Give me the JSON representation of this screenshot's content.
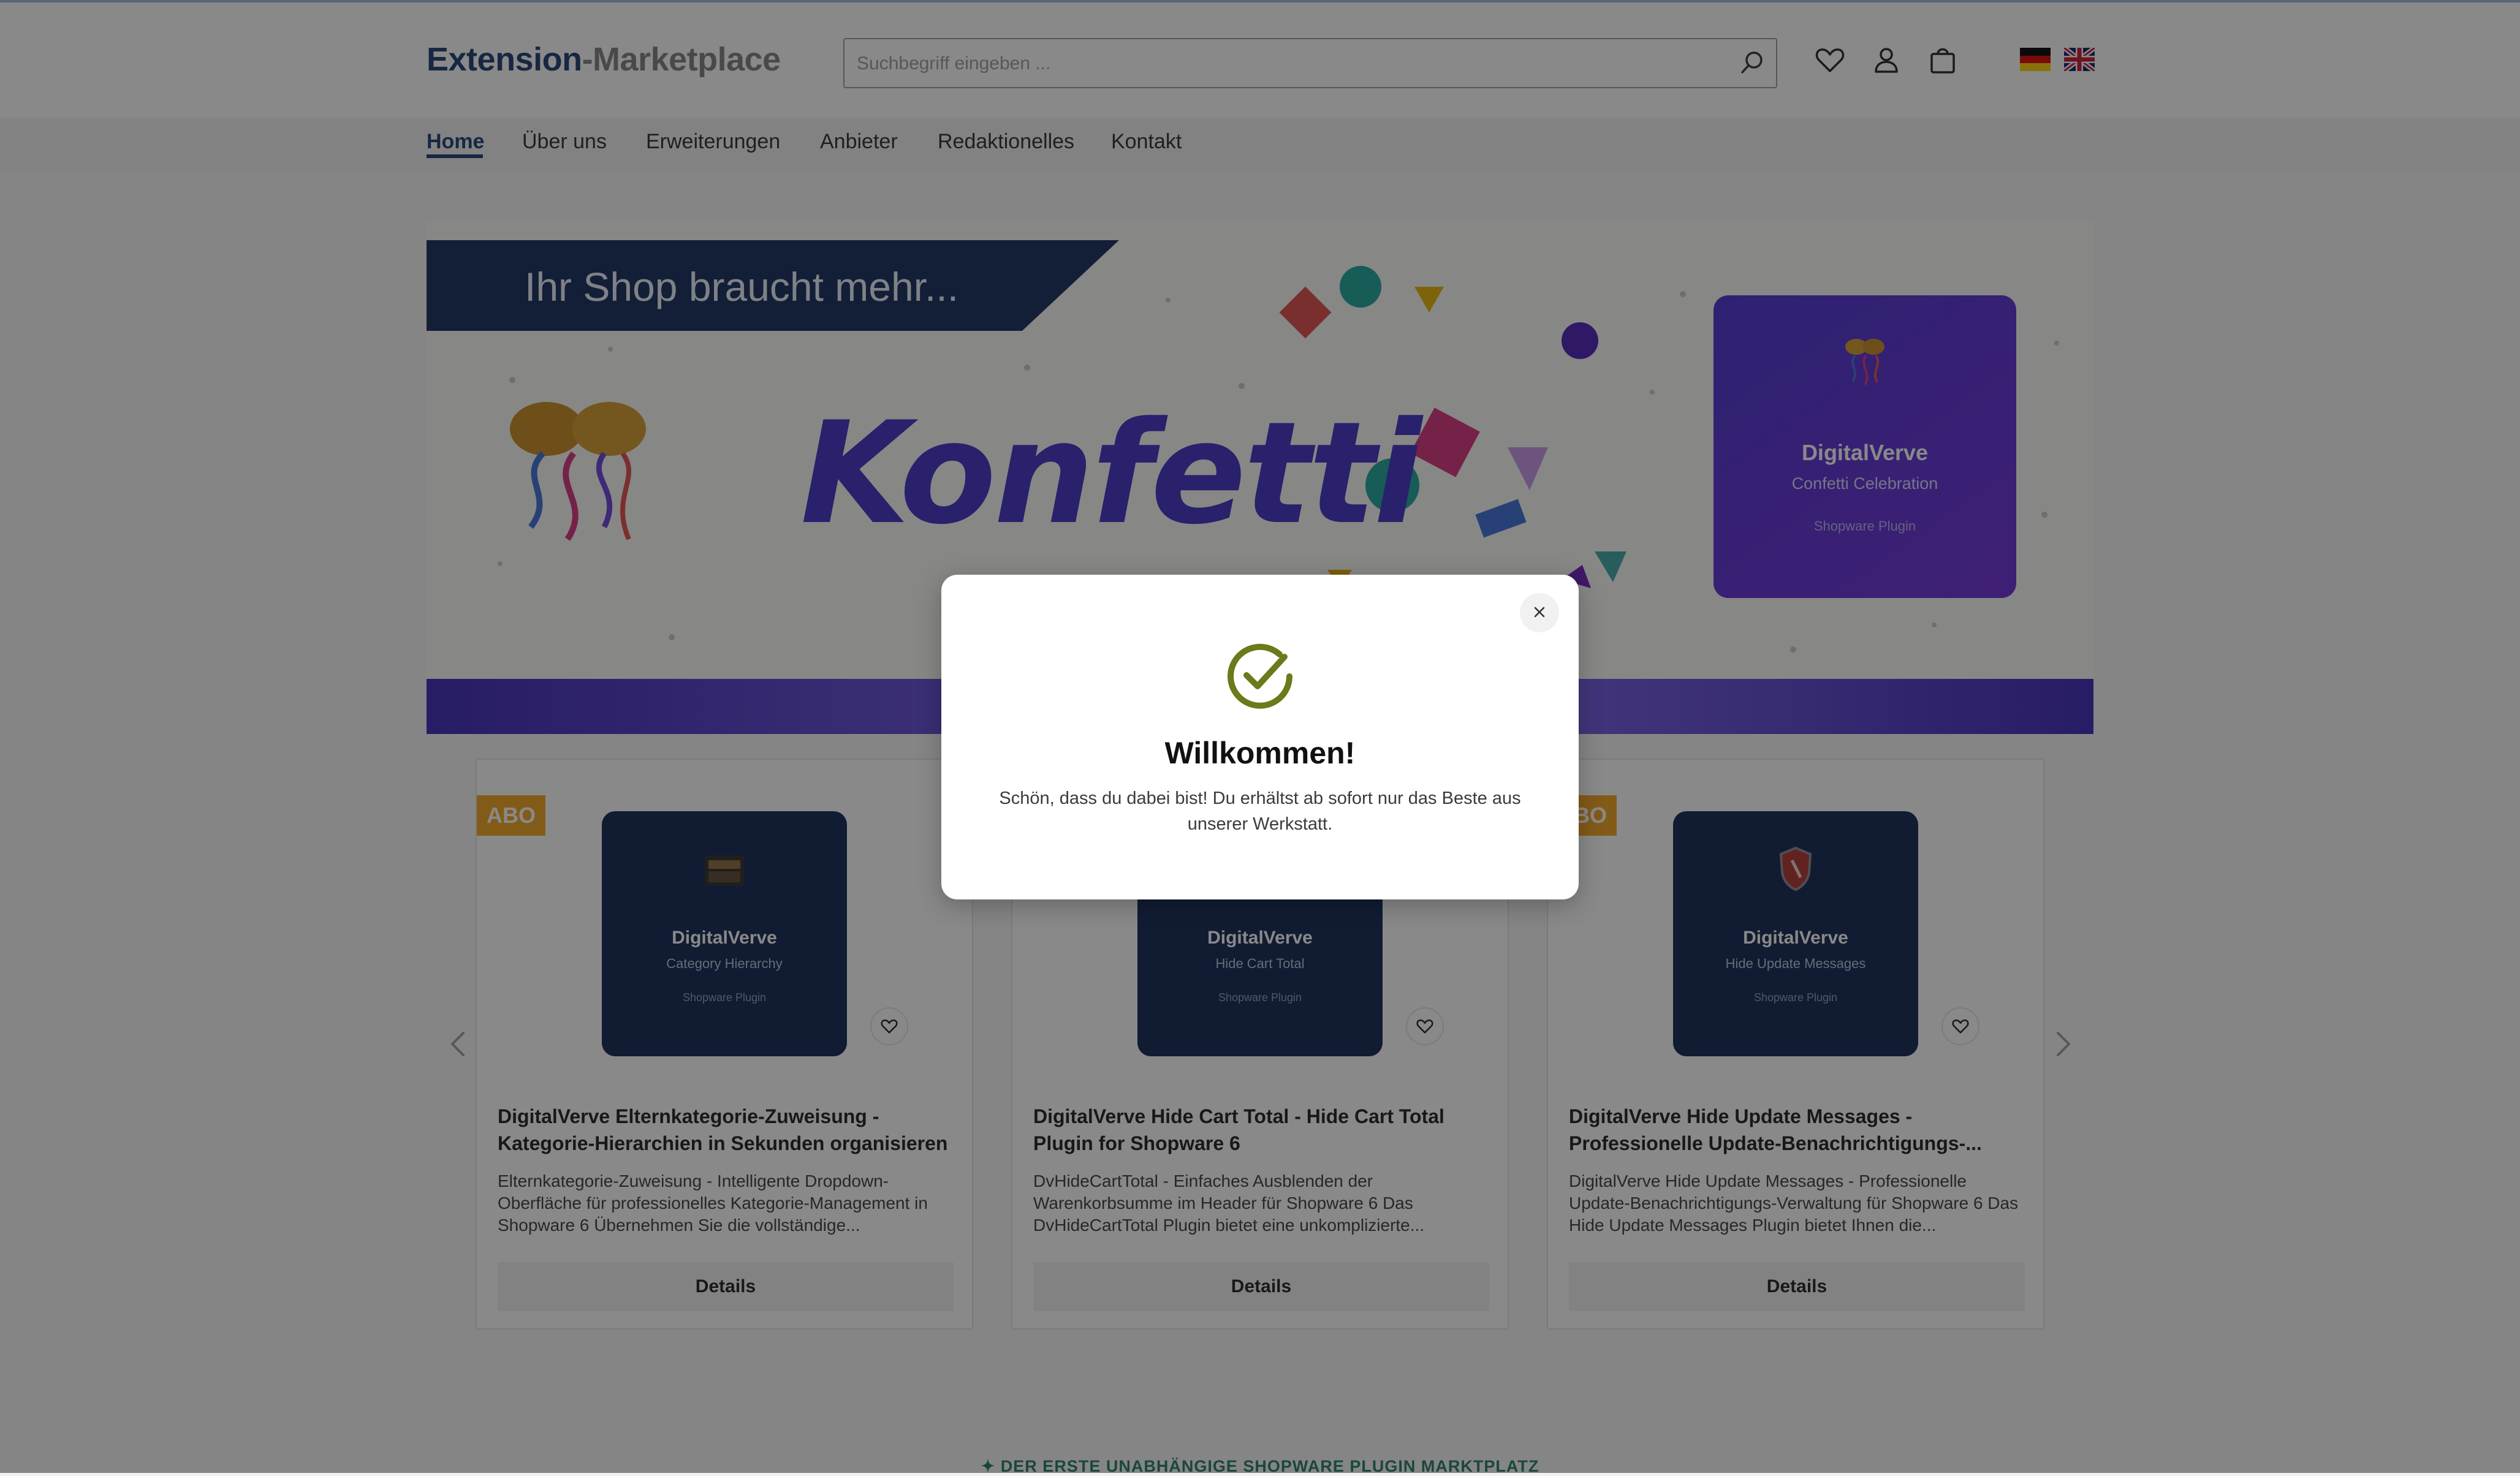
{
  "header": {
    "logo_part1": "Extension",
    "logo_part2": "-Marketplace",
    "search_placeholder": "Suchbegriff eingeben ...",
    "icons": [
      "search-icon",
      "heart-icon",
      "user-icon",
      "bag-icon"
    ],
    "languages": [
      "de-flag",
      "uk-flag"
    ]
  },
  "nav": {
    "items": [
      {
        "label": "Home",
        "active": true
      },
      {
        "label": "Über uns"
      },
      {
        "label": "Erweiterungen"
      },
      {
        "label": "Anbieter"
      },
      {
        "label": "Redaktionelles"
      },
      {
        "label": "Kontakt"
      }
    ]
  },
  "banner": {
    "tagline": "Ihr Shop braucht mehr...",
    "headline": "Konfetti",
    "card": {
      "brand": "DigitalVerve",
      "name": "Confetti Celebration",
      "note": "Shopware Plugin"
    }
  },
  "products": [
    {
      "badge": "ABO",
      "card_brand": "DigitalVerve",
      "card_name": "Category Hierarchy",
      "card_note": "Shopware Plugin",
      "title": "DigitalVerve Elternkategorie-Zuweisung - Kategorie-Hierarchien in Sekunden organisieren",
      "description": "Elternkategorie-Zuweisung - Intelligente Dropdown-Oberfläche für professionelles Kategorie-Management in Shopware 6 Übernehmen Sie die vollständige...",
      "button": "Details"
    },
    {
      "badge": "",
      "card_brand": "DigitalVerve",
      "card_name": "Hide Cart Total",
      "card_note": "Shopware Plugin",
      "title": "DigitalVerve Hide Cart Total - Hide Cart Total Plugin for Shopware 6",
      "description": "DvHideCartTotal - Einfaches Ausblenden der Warenkorbsumme im Header für Shopware 6 Das DvHideCartTotal Plugin bietet eine unkomplizierte...",
      "button": "Details"
    },
    {
      "badge": "BO",
      "card_brand": "DigitalVerve",
      "card_name": "Hide Update Messages",
      "card_note": "Shopware Plugin",
      "title": "DigitalVerve Hide Update Messages - Professionelle Update-Benachrichtigungs-...",
      "description": "DigitalVerve Hide Update Messages - Professionelle Update-Benachrichtigungs-Verwaltung für Shopware 6 Das Hide Update Messages Plugin bietet Ihnen die...",
      "button": "Details"
    }
  ],
  "footer": {
    "tagline": "✦ DER ERSTE UNABHÄNGIGE SHOPWARE PLUGIN MARKTPLATZ"
  },
  "modal": {
    "title": "Willkommen!",
    "text": "Schön, dass du dabei bist! Du erhältst ab sofort nur das Beste aus unserer Werkstatt.",
    "check_color": "#6b7a1a"
  },
  "colors": {
    "brand_navy": "#1a3b73",
    "badge_orange": "#f2a21c",
    "card_navy": "#0f2553",
    "banner_purple": "#4a2fd0",
    "footer_green": "#217a67"
  }
}
